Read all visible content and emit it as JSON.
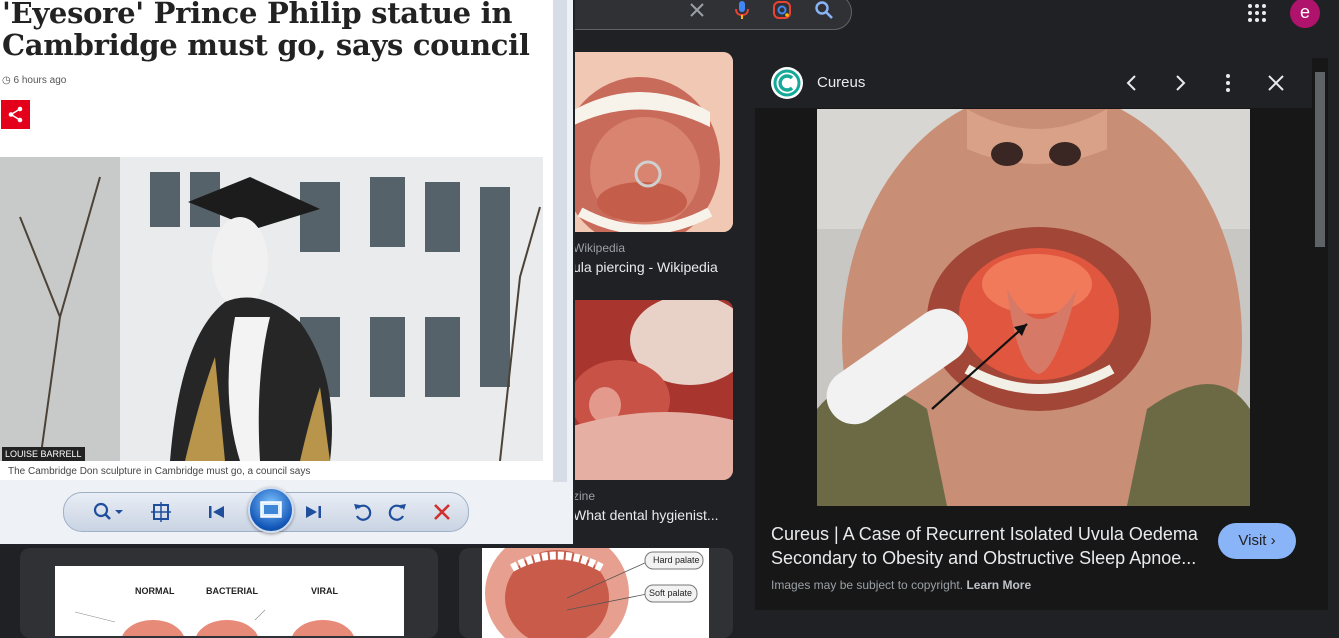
{
  "google": {
    "avatar_letter": "e"
  },
  "grid": {
    "results": [
      {
        "source": "Wikipedia",
        "title": "ula piercing - Wikipedia"
      },
      {
        "source": "zine",
        "title": "What dental hygienist..."
      }
    ]
  },
  "diagram": {
    "labels": [
      "NORMAL",
      "BACTERIAL",
      "VIRAL"
    ],
    "palate_labels": [
      "Hard palate",
      "Soft palate"
    ]
  },
  "preview": {
    "site_name": "Cureus",
    "title": "Cureus | A Case of Recurrent Isolated Uvula Oedema Secondary to Obesity and Obstructive Sleep Apnoe...",
    "visit_label": "Visit",
    "copyright_prefix": "Images may be subject to copyright.",
    "learn_more": "Learn More"
  },
  "viewer": {
    "headline": "'Eyesore' Prince Philip statue in Cambridge must go, says council",
    "timestamp": "6 hours ago",
    "photo_credit": "LOUISE BARRELL",
    "photo_caption": "The Cambridge Don sculpture in Cambridge must go, a council says"
  },
  "colors": {
    "google_bg": "#202124",
    "accent_blue": "#8ab4f8",
    "share_red": "#e4001b",
    "avatar": "#b0136b"
  }
}
